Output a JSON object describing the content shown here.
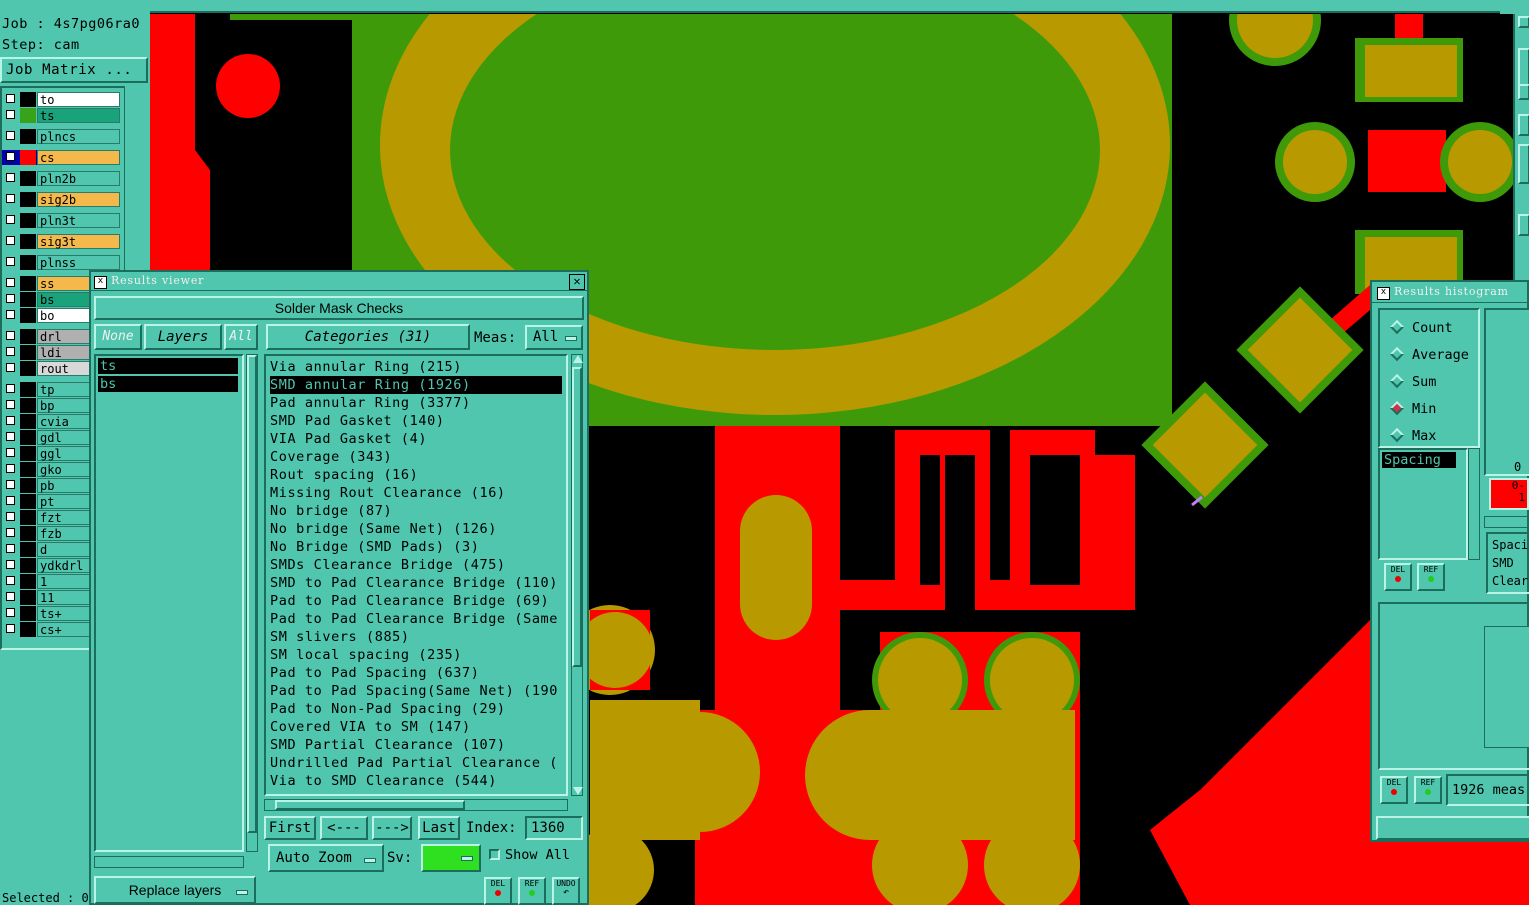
{
  "job": {
    "job_label": "Job : 4s7pg06ra0",
    "step_label": "Step: cam",
    "job_matrix_button": "Job Matrix ..."
  },
  "layers": [
    {
      "name": "to",
      "color": "#ffffff",
      "swatch": "#000000"
    },
    {
      "name": "ts",
      "color": "#1aa37a",
      "swatch": "#37a31a"
    },
    {
      "name": "plncs",
      "color": "#4fc6ad",
      "swatch": "#000000"
    },
    {
      "name": "cs",
      "color": "#f5b84a",
      "swatch": "#ff0000"
    },
    {
      "name": "pln2b",
      "color": "#4fc6ad",
      "swatch": "#000000"
    },
    {
      "name": "sig2b",
      "color": "#f5b84a",
      "swatch": "#000000"
    },
    {
      "name": "pln3t",
      "color": "#4fc6ad",
      "swatch": "#000000"
    },
    {
      "name": "sig3t",
      "color": "#f5b84a",
      "swatch": "#000000"
    },
    {
      "name": "plnss",
      "color": "#4fc6ad",
      "swatch": "#000000"
    },
    {
      "name": "ss",
      "color": "#f5b84a",
      "swatch": "#000000"
    },
    {
      "name": "bs",
      "color": "#1aa37a",
      "swatch": "#000000"
    },
    {
      "name": "bo",
      "color": "#ffffff",
      "swatch": "#000000"
    },
    {
      "name": "drl",
      "color": "#b0b0b0",
      "swatch": "#000000"
    },
    {
      "name": "ldi",
      "color": "#b0b0b0",
      "swatch": "#000000"
    },
    {
      "name": "rout",
      "color": "#d8d8d8",
      "swatch": "#000000"
    },
    {
      "name": "tp",
      "color": "#4fc6ad",
      "swatch": "#000000"
    },
    {
      "name": "bp",
      "color": "#4fc6ad",
      "swatch": "#000000"
    },
    {
      "name": "cvia",
      "color": "#4fc6ad",
      "swatch": "#000000"
    },
    {
      "name": "gdl",
      "color": "#4fc6ad",
      "swatch": "#000000"
    },
    {
      "name": "ggl",
      "color": "#4fc6ad",
      "swatch": "#000000"
    },
    {
      "name": "gko",
      "color": "#4fc6ad",
      "swatch": "#000000"
    },
    {
      "name": "pb",
      "color": "#4fc6ad",
      "swatch": "#000000"
    },
    {
      "name": "pt",
      "color": "#4fc6ad",
      "swatch": "#000000"
    },
    {
      "name": "fzt",
      "color": "#4fc6ad",
      "swatch": "#000000"
    },
    {
      "name": "fzb",
      "color": "#4fc6ad",
      "swatch": "#000000"
    },
    {
      "name": "d",
      "color": "#4fc6ad",
      "swatch": "#000000"
    },
    {
      "name": "ydkdrl",
      "color": "#4fc6ad",
      "swatch": "#000000"
    },
    {
      "name": "1",
      "color": "#4fc6ad",
      "swatch": "#000000"
    },
    {
      "name": "11",
      "color": "#4fc6ad",
      "swatch": "#000000"
    },
    {
      "name": "ts+",
      "color": "#4fc6ad",
      "swatch": "#000000"
    },
    {
      "name": "cs+",
      "color": "#4fc6ad",
      "swatch": "#000000"
    }
  ],
  "selected_label": "Selected : 0",
  "results_viewer": {
    "title": "Results viewer",
    "header": "Solder Mask Checks",
    "none_button": "None",
    "layers_button": "Layers",
    "all_button": "All",
    "categories_button": "Categories (31)",
    "meas_label": "Meas:",
    "meas_value": "All",
    "layer_list": [
      "ts",
      "bs"
    ],
    "categories": [
      "Via annular Ring (215)",
      "SMD annular Ring (1926)",
      "Pad annular Ring (3377)",
      "SMD Pad Gasket (140)",
      "VIA Pad Gasket (4)",
      "Coverage (343)",
      "Rout spacing (16)",
      "Missing Rout Clearance (16)",
      "No bridge (87)",
      "No bridge (Same Net) (126)",
      "No Bridge (SMD Pads) (3)",
      "SMDs Clearance Bridge (475)",
      "SMD to Pad Clearance Bridge (110)",
      "Pad to Pad Clearance Bridge (69)",
      "Pad to Pad Clearance Bridge (Same",
      "SM slivers (885)",
      "SM local spacing (235)",
      "Pad to Pad Spacing (637)",
      "Pad to Pad Spacing(Same Net) (190",
      "Pad to Non-Pad Spacing (29)",
      "Covered VIA to SM (147)",
      "SMD Partial Clearance (107)",
      "Undrilled Pad Partial Clearance (",
      "Via to SMD Clearance (544)"
    ],
    "selected_category_index": 1,
    "first_button": "First",
    "prev_button": "<---",
    "next_button": "--->",
    "last_button": "Last",
    "index_label": "Index:",
    "index_value": "1360",
    "auto_zoom": "Auto Zoom",
    "sv_label": "Sv:",
    "show_all": "Show All",
    "replace_layers": "Replace layers",
    "del_label": "DEL",
    "ref_label": "REF",
    "undo_label": "UNDO"
  },
  "histogram": {
    "title": "Results histogram",
    "options": [
      "Count",
      "Average",
      "Sum",
      "Min",
      "Max"
    ],
    "selected_option": "Min",
    "list": [
      "Spacing"
    ],
    "zero_label": "0",
    "bar_label": "0-\n1",
    "side_list": [
      "Spaci",
      "SMD",
      "Clear"
    ],
    "measure_text": "1926 meas",
    "del_label": "DEL",
    "ref_label": "REF"
  },
  "colors": {
    "teal": "#4fc6ad",
    "green": "#3a9a10",
    "gold": "#b89a00",
    "red": "#ff0000",
    "black": "#000000"
  }
}
